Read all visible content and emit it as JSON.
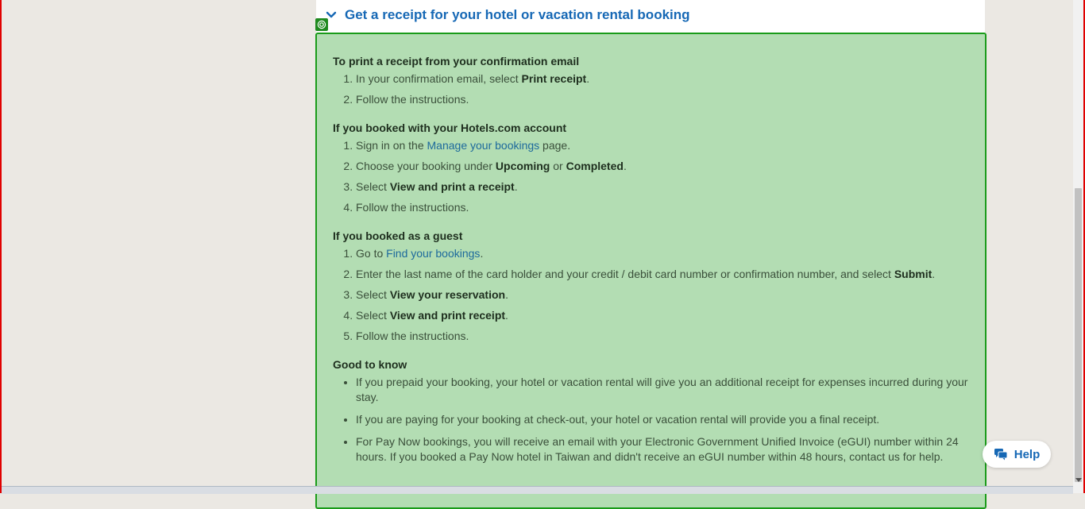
{
  "accordion": {
    "title": "Get a receipt for your hotel or vacation rental booking"
  },
  "panel": {
    "section1": {
      "title": "To print a receipt from your confirmation email",
      "items": [
        {
          "pre": "In your confirmation email, select ",
          "bold": "Print receipt",
          "post": "."
        },
        {
          "pre": "Follow the instructions.",
          "bold": "",
          "post": ""
        }
      ]
    },
    "section2": {
      "title": "If you booked with your Hotels.com account",
      "item1_pre": "Sign in on the ",
      "item1_link": "Manage your bookings",
      "item1_post": " page.",
      "item2_pre": "Choose your booking under ",
      "item2_bold1": "Upcoming",
      "item2_mid": " or ",
      "item2_bold2": "Completed",
      "item2_post": ".",
      "item3_pre": "Select ",
      "item3_bold": "View and print a receipt",
      "item3_post": ".",
      "item4": "Follow the instructions."
    },
    "section3": {
      "title": "If you booked as a guest",
      "item1_pre": "Go to ",
      "item1_link": "Find your bookings",
      "item1_post": ".",
      "item2_pre": "Enter the last name of the card holder and your credit / debit card number or confirmation number, and select ",
      "item2_bold": "Submit",
      "item2_post": ".",
      "item3_pre": "Select ",
      "item3_bold": "View your reservation",
      "item3_post": ".",
      "item4_pre": "Select ",
      "item4_bold": "View and print receipt",
      "item4_post": ".",
      "item5": "Follow the instructions."
    },
    "section4": {
      "title": "Good to know",
      "bullets": [
        "If you prepaid your booking, your hotel or vacation rental will give you an additional receipt for expenses incurred during your stay.",
        "If you are paying for your booking at check-out, your hotel or vacation rental will provide you a final receipt.",
        "For Pay Now bookings, you will receive an email with your Electronic Government Unified Invoice (eGUI) number within 24 hours. If you booked a Pay Now hotel in Taiwan and didn't receive an eGUI number within 48 hours, contact us for help."
      ]
    }
  },
  "help": {
    "label": "Help"
  },
  "colors": {
    "accent": "#1668b5",
    "panel_bg": "#b3ddb3",
    "panel_border": "#1a9b1a",
    "link": "#1d6a9c",
    "frame_border": "#e00000"
  }
}
